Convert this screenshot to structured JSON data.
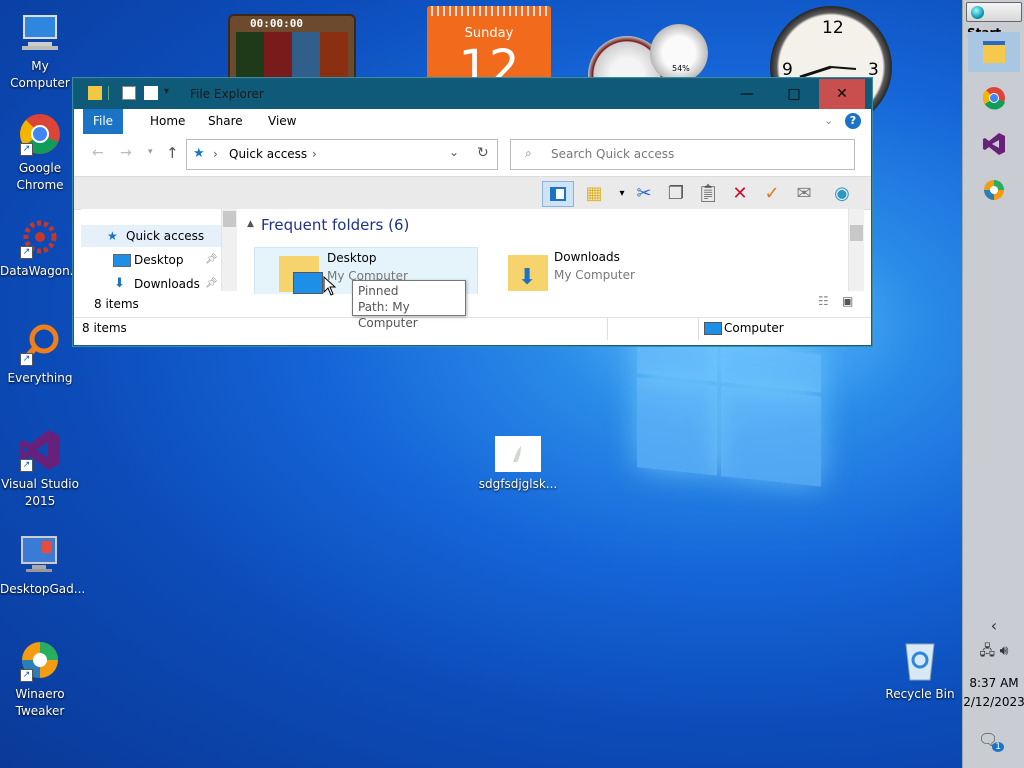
{
  "desktop": {
    "icons": [
      {
        "label": "My Computer"
      },
      {
        "label": "Google Chrome"
      },
      {
        "label": "DataWagon..."
      },
      {
        "label": "Everything"
      },
      {
        "label": "Visual Studio 2015"
      },
      {
        "label": "DesktopGad..."
      },
      {
        "label": "Winaero Tweaker"
      },
      {
        "label": "sdgfsdjglsk..."
      },
      {
        "label": "Recycle Bin"
      }
    ]
  },
  "gadgets": {
    "timer": "00:00:00",
    "calendar_day": "Sunday",
    "calendar_date": "12",
    "meter_percent": "54%",
    "clock_numbers": [
      "12",
      "3",
      "9"
    ]
  },
  "taskbar": {
    "start_label": "Start",
    "time": "8:37 AM",
    "date": "2/12/2023",
    "notification_count": "1"
  },
  "explorer": {
    "title": "File Explorer",
    "tabs": [
      "File",
      "Home",
      "Share",
      "View"
    ],
    "address": "Quick access",
    "search_placeholder": "Search Quick access",
    "nav_items": [
      "Quick access",
      "Desktop",
      "Downloads"
    ],
    "nav_count": "8 items",
    "section_header": "Frequent folders (6)",
    "folders": [
      {
        "name": "Desktop",
        "location": "My Computer"
      },
      {
        "name": "Downloads",
        "location": "My Computer"
      }
    ],
    "status_items": "8 items",
    "status_location": "Computer",
    "tooltip_line1": "Pinned",
    "tooltip_line2": "Path: My Computer"
  }
}
